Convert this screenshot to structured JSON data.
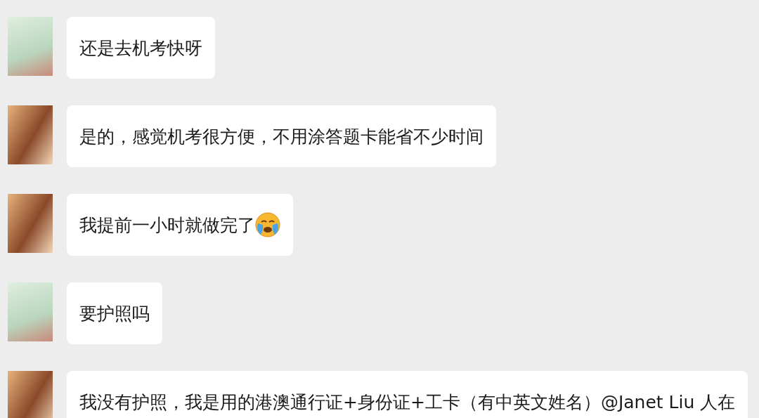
{
  "messages": [
    {
      "kind": "illustration",
      "text": "还是去机考快呀",
      "emoji": false
    },
    {
      "kind": "photo",
      "text": "是的，感觉机考很方便，不用涂答题卡能省不少时间",
      "emoji": false
    },
    {
      "kind": "photo",
      "text": "我提前一小时就做完了",
      "emoji": true
    },
    {
      "kind": "illustration",
      "text": "要护照吗",
      "emoji": false
    },
    {
      "kind": "photo",
      "text": "我没有护照，我是用的港澳通行证+身份证+工卡（有中英文姓名）@Janet Liu 人在",
      "emoji": false
    }
  ]
}
